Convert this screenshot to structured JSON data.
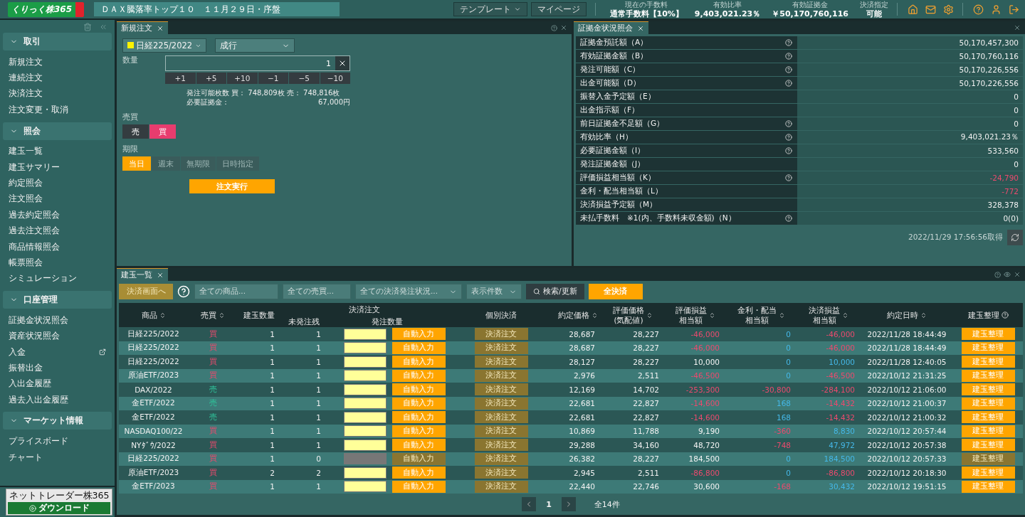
{
  "topbar": {
    "logo": "くりっく株365",
    "ticker": "ＤＡＸ騰落率トップ１０　１１月２９日・序盤",
    "buttons": [
      {
        "label": "テンプレート",
        "dropdown": true
      },
      {
        "label": "マイページ",
        "dropdown": false
      }
    ],
    "stats": [
      {
        "label": "現在の手数料",
        "value": "通常手数料【10%】"
      },
      {
        "label": "有効比率",
        "value": "9,403,021.23％"
      },
      {
        "label": "有効証拠金",
        "value": "￥50,170,760,116"
      },
      {
        "label": "決済指定",
        "value": "可能"
      }
    ]
  },
  "sidebar": {
    "sections": [
      {
        "title": "取引",
        "expanded": true,
        "items": [
          {
            "label": "新規注文",
            "external": false
          },
          {
            "label": "連続注文",
            "external": false
          },
          {
            "label": "決済注文",
            "external": false
          },
          {
            "label": "注文変更・取消",
            "external": false
          }
        ]
      },
      {
        "title": "照会",
        "expanded": true,
        "items": [
          {
            "label": "建玉一覧",
            "external": false
          },
          {
            "label": "建玉サマリー",
            "external": false
          },
          {
            "label": "約定照会",
            "external": false
          },
          {
            "label": "注文照会",
            "external": false
          },
          {
            "label": "過去約定照会",
            "external": false
          },
          {
            "label": "過去注文照会",
            "external": false
          },
          {
            "label": "商品情報照会",
            "external": false
          },
          {
            "label": "帳票照会",
            "external": false
          },
          {
            "label": "シミュレーション",
            "external": false
          }
        ]
      },
      {
        "title": "口座管理",
        "expanded": true,
        "items": [
          {
            "label": "証拠金状況照会",
            "external": false
          },
          {
            "label": "資産状況照会",
            "external": false
          },
          {
            "label": "入金",
            "external": true
          },
          {
            "label": "振替出金",
            "external": false
          },
          {
            "label": "入出金履歴",
            "external": false
          },
          {
            "label": "過去入出金履歴",
            "external": false
          }
        ]
      },
      {
        "title": "マーケット情報",
        "expanded": true,
        "items": [
          {
            "label": "プライスボード",
            "external": false
          },
          {
            "label": "チャート",
            "external": false
          }
        ]
      }
    ],
    "download": {
      "caption": "ネットトレーダー株365",
      "label": "ダウンロード"
    }
  },
  "order": {
    "tab": "新規注文",
    "product": "日経225/2022",
    "order_type": "成行",
    "quantity_label": "数量",
    "quantity": "1",
    "steps": [
      "+1",
      "+5",
      "+10",
      "−1",
      "−5",
      "−10"
    ],
    "available": "発注可能枚数 買： 748,809枚 売： 748,816枚",
    "margin_label": "必要証拠金：",
    "margin_value": "67,000円",
    "side_label": "売買",
    "sides": [
      {
        "label": "売",
        "selected": false
      },
      {
        "label": "買",
        "selected": true
      }
    ],
    "period_label": "期限",
    "periods": [
      {
        "label": "当日",
        "selected": true
      },
      {
        "label": "週末",
        "selected": false
      },
      {
        "label": "無期限",
        "selected": false
      },
      {
        "label": "日時指定",
        "selected": false
      }
    ],
    "submit": "注文実行"
  },
  "margin": {
    "tab": "証拠金状況照会",
    "rows": [
      {
        "label": "証拠金預託額（A）",
        "help": true,
        "value": "50,170,457,300",
        "loss": false
      },
      {
        "label": "有効証拠金額（B）",
        "help": true,
        "value": "50,170,760,116",
        "loss": false
      },
      {
        "label": "発注可能額（C）",
        "help": true,
        "value": "50,170,226,556",
        "loss": false
      },
      {
        "label": "出金可能額（D）",
        "help": true,
        "value": "50,170,226,556",
        "loss": false
      },
      {
        "label": "振替入金予定額（E）",
        "help": false,
        "value": "0",
        "loss": false
      },
      {
        "label": "出金指示額（F）",
        "help": false,
        "value": "0",
        "loss": false
      },
      {
        "label": "前日証拠金不足額（G）",
        "help": true,
        "value": "0",
        "loss": false
      },
      {
        "label": "有効比率（H）",
        "help": true,
        "value": "9,403,021.23％",
        "loss": false
      },
      {
        "label": "必要証拠金額（I）",
        "help": true,
        "value": "533,560",
        "loss": false
      },
      {
        "label": "発注証拠金額（J）",
        "help": false,
        "value": "0",
        "loss": false
      },
      {
        "label": "評価損益相当額（K）",
        "help": true,
        "value": "-24,790",
        "loss": true
      },
      {
        "label": "金利・配当相当額（L）",
        "help": false,
        "value": "-772",
        "loss": true
      },
      {
        "label": "決済損益予定額（M）",
        "help": false,
        "value": "328,378",
        "loss": false
      },
      {
        "label": "未払手数料　※1(内、手数料未収金額)（N）",
        "help": true,
        "value": "0(0)",
        "loss": false
      }
    ],
    "timestamp": "2022/11/29 17:56:56取得"
  },
  "positions": {
    "tab": "建玉一覧",
    "toolbar": {
      "close_screen": "決済画面へ",
      "close_screen_disabled": true,
      "product_placeholder": "全ての商品...",
      "side_placeholder": "全ての売買...",
      "status_select": "全ての決済発注状況...",
      "count_select": "表示件数",
      "search": "検索/更新",
      "close_all": "全決済"
    },
    "group_header": "決済注文",
    "columns": [
      {
        "lines": [
          "商品"
        ],
        "sort": true
      },
      {
        "lines": [
          "売買"
        ],
        "sort": true
      },
      {
        "lines": [
          "建玉数量"
        ],
        "sort": false
      },
      {
        "lines": [
          "未発注残"
        ],
        "sort": false
      },
      {
        "lines": [
          "発注数量"
        ],
        "sort": false
      },
      {
        "lines": [
          "個別決済"
        ],
        "sort": false
      },
      {
        "lines": [
          "約定価格"
        ],
        "sort": true
      },
      {
        "lines": [
          "評価価格",
          "(気配値)"
        ],
        "sort": true
      },
      {
        "lines": [
          "評価損益",
          "相当額"
        ],
        "sort": true
      },
      {
        "lines": [
          "金利・配当",
          "相当額"
        ],
        "sort": true
      },
      {
        "lines": [
          "決済損益",
          "相当額"
        ],
        "sort": true
      },
      {
        "lines": [
          "約定日時"
        ],
        "sort": true
      },
      {
        "lines": [
          "建玉整理"
        ],
        "sort": false,
        "help": true
      }
    ],
    "rows": [
      {
        "product": "日経225/2022",
        "side": "買",
        "sell": false,
        "qty": "1",
        "open": "1",
        "input_disabled": false,
        "auto": "自動入力",
        "close": "決済注文",
        "close_disabled": true,
        "price": "28,687",
        "quote": "28,227",
        "eval": {
          "text": "-46,000",
          "loss": true
        },
        "interest": {
          "text": "0",
          "loss": false
        },
        "settle": {
          "text": "-46,000",
          "loss": true
        },
        "time": "2022/11/28 18:44:49",
        "organize": "建玉整理",
        "organize_disabled": false
      },
      {
        "product": "日経225/2022",
        "side": "買",
        "sell": false,
        "qty": "1",
        "open": "1",
        "input_disabled": false,
        "auto": "自動入力",
        "close": "決済注文",
        "close_disabled": true,
        "price": "28,687",
        "quote": "28,227",
        "eval": {
          "text": "-46,000",
          "loss": true
        },
        "interest": {
          "text": "0",
          "loss": false
        },
        "settle": {
          "text": "-46,000",
          "loss": true
        },
        "time": "2022/11/28 18:44:49",
        "organize": "建玉整理",
        "organize_disabled": false
      },
      {
        "product": "日経225/2022",
        "side": "買",
        "sell": false,
        "qty": "1",
        "open": "1",
        "input_disabled": false,
        "auto": "自動入力",
        "close": "決済注文",
        "close_disabled": true,
        "price": "28,127",
        "quote": "28,227",
        "eval": {
          "text": "10,000",
          "loss": false
        },
        "interest": {
          "text": "0",
          "loss": false
        },
        "settle": {
          "text": "10,000",
          "loss": false
        },
        "time": "2022/11/28 12:40:05",
        "organize": "建玉整理",
        "organize_disabled": false
      },
      {
        "product": "原油ETF/2023",
        "side": "買",
        "sell": false,
        "qty": "1",
        "open": "1",
        "input_disabled": false,
        "auto": "自動入力",
        "close": "決済注文",
        "close_disabled": true,
        "price": "2,976",
        "quote": "2,511",
        "eval": {
          "text": "-46,500",
          "loss": true
        },
        "interest": {
          "text": "0",
          "loss": false
        },
        "settle": {
          "text": "-46,500",
          "loss": true
        },
        "time": "2022/10/12 21:31:25",
        "organize": "建玉整理",
        "organize_disabled": false
      },
      {
        "product": "DAX/2022",
        "side": "売",
        "sell": true,
        "qty": "1",
        "open": "1",
        "input_disabled": false,
        "auto": "自動入力",
        "close": "決済注文",
        "close_disabled": true,
        "price": "12,169",
        "quote": "14,702",
        "eval": {
          "text": "-253,300",
          "loss": true
        },
        "interest": {
          "text": "-30,800",
          "loss": true
        },
        "settle": {
          "text": "-284,100",
          "loss": true
        },
        "time": "2022/10/12 21:06:00",
        "organize": "建玉整理",
        "organize_disabled": false
      },
      {
        "product": "金ETF/2022",
        "side": "売",
        "sell": true,
        "qty": "1",
        "open": "1",
        "input_disabled": false,
        "auto": "自動入力",
        "close": "決済注文",
        "close_disabled": true,
        "price": "22,681",
        "quote": "22,827",
        "eval": {
          "text": "-14,600",
          "loss": true
        },
        "interest": {
          "text": "168",
          "loss": false
        },
        "settle": {
          "text": "-14,432",
          "loss": true
        },
        "time": "2022/10/12 21:00:37",
        "organize": "建玉整理",
        "organize_disabled": false
      },
      {
        "product": "金ETF/2022",
        "side": "売",
        "sell": true,
        "qty": "1",
        "open": "1",
        "input_disabled": false,
        "auto": "自動入力",
        "close": "決済注文",
        "close_disabled": true,
        "price": "22,681",
        "quote": "22,827",
        "eval": {
          "text": "-14,600",
          "loss": true
        },
        "interest": {
          "text": "168",
          "loss": false
        },
        "settle": {
          "text": "-14,432",
          "loss": true
        },
        "time": "2022/10/12 21:00:32",
        "organize": "建玉整理",
        "organize_disabled": false
      },
      {
        "product": "NASDAQ100/22",
        "side": "買",
        "sell": false,
        "qty": "1",
        "open": "1",
        "input_disabled": false,
        "auto": "自動入力",
        "close": "決済注文",
        "close_disabled": true,
        "price": "10,869",
        "quote": "11,788",
        "eval": {
          "text": "9,190",
          "loss": false
        },
        "interest": {
          "text": "-360",
          "loss": true
        },
        "settle": {
          "text": "8,830",
          "loss": false
        },
        "time": "2022/10/12 20:57:44",
        "organize": "建玉整理",
        "organize_disabled": false
      },
      {
        "product": "NYﾀﾞｳ/2022",
        "side": "買",
        "sell": false,
        "qty": "1",
        "open": "1",
        "input_disabled": false,
        "auto": "自動入力",
        "close": "決済注文",
        "close_disabled": true,
        "price": "29,288",
        "quote": "34,160",
        "eval": {
          "text": "48,720",
          "loss": false
        },
        "interest": {
          "text": "-748",
          "loss": true
        },
        "settle": {
          "text": "47,972",
          "loss": false
        },
        "time": "2022/10/12 20:57:38",
        "organize": "建玉整理",
        "organize_disabled": false
      },
      {
        "product": "日経225/2022",
        "side": "買",
        "sell": false,
        "qty": "1",
        "open": "0",
        "input_disabled": true,
        "auto": "自動入力",
        "close": "決済注文",
        "close_disabled": true,
        "price": "26,382",
        "quote": "28,227",
        "eval": {
          "text": "184,500",
          "loss": false
        },
        "interest": {
          "text": "0",
          "loss": false
        },
        "settle": {
          "text": "184,500",
          "loss": false
        },
        "time": "2022/10/12 20:57:33",
        "organize": "建玉整理",
        "organize_disabled": true
      },
      {
        "product": "原油ETF/2023",
        "side": "買",
        "sell": false,
        "qty": "2",
        "open": "2",
        "input_disabled": false,
        "auto": "自動入力",
        "close": "決済注文",
        "close_disabled": true,
        "price": "2,945",
        "quote": "2,511",
        "eval": {
          "text": "-86,800",
          "loss": true
        },
        "interest": {
          "text": "0",
          "loss": false
        },
        "settle": {
          "text": "-86,800",
          "loss": true
        },
        "time": "2022/10/12 20:18:30",
        "organize": "建玉整理",
        "organize_disabled": false
      },
      {
        "product": "金ETF/2023",
        "side": "買",
        "sell": false,
        "qty": "1",
        "open": "1",
        "input_disabled": false,
        "auto": "自動入力",
        "close": "決済注文",
        "close_disabled": true,
        "price": "22,440",
        "quote": "22,746",
        "eval": {
          "text": "30,600",
          "loss": false
        },
        "interest": {
          "text": "-168",
          "loss": true
        },
        "settle": {
          "text": "30,432",
          "loss": false
        },
        "time": "2022/10/12 19:51:15",
        "organize": "建玉整理",
        "organize_disabled": false
      }
    ],
    "page": "1",
    "total": "全14件"
  }
}
